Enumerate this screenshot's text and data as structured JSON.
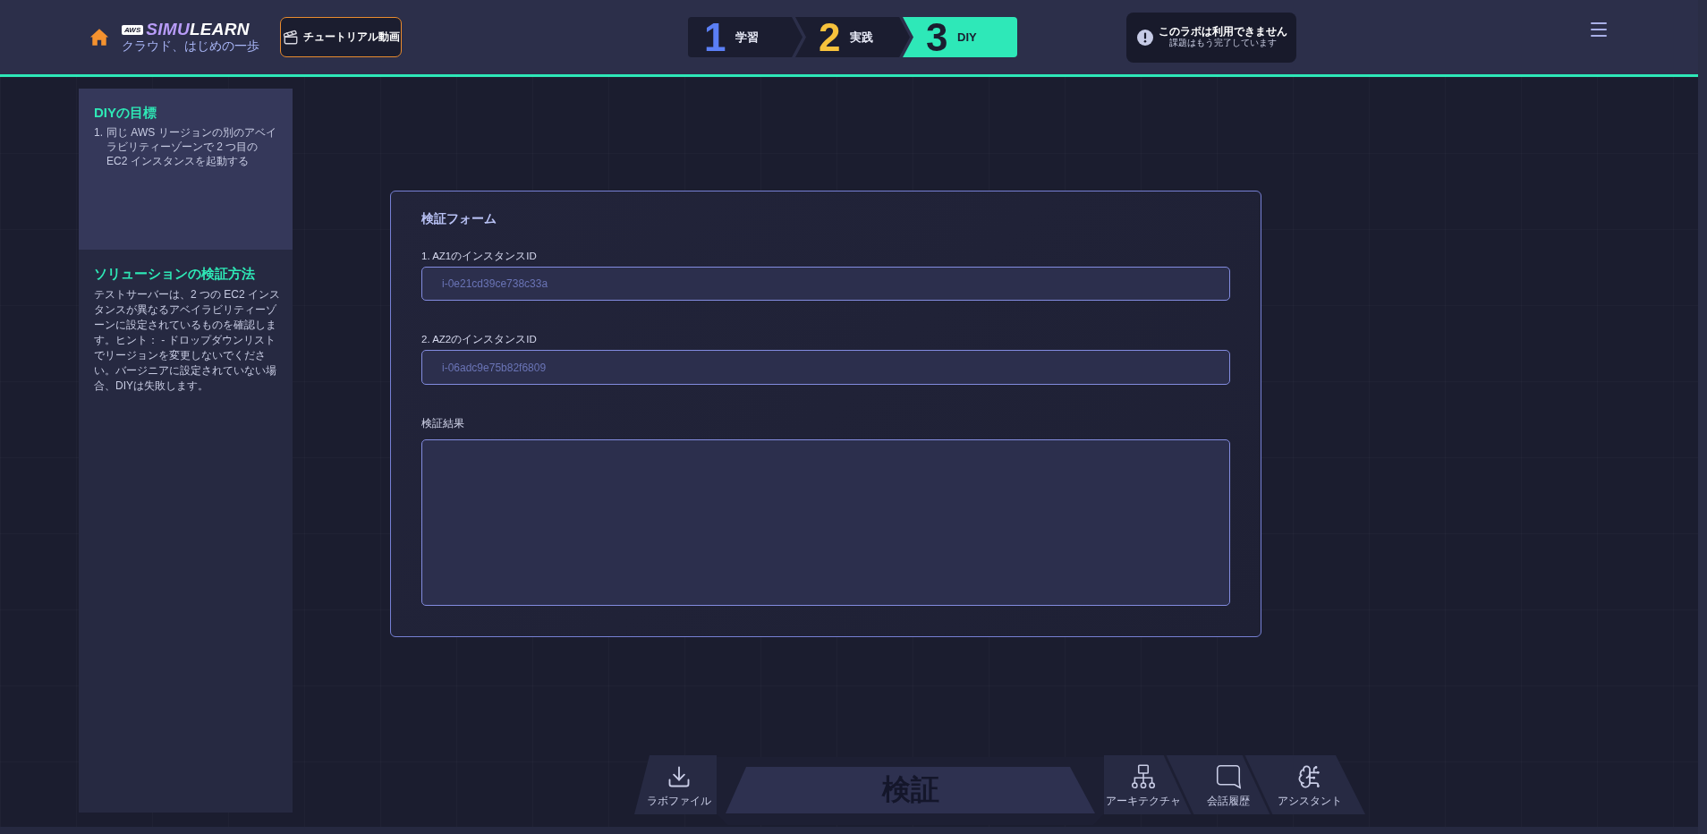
{
  "header": {
    "logo": {
      "badge": "AWS",
      "wordmark_parts": [
        "SIMU",
        "LEARN"
      ],
      "tagline": "クラウド、はじめの一歩"
    },
    "tutorial_button": {
      "label": "チュートリアル動画"
    },
    "steps": [
      {
        "number": "1",
        "label": "学習",
        "selected": false,
        "color": "#5b7ff5"
      },
      {
        "number": "2",
        "label": "実践",
        "selected": false,
        "color": "#f7c23c"
      },
      {
        "number": "3",
        "label": "DIY",
        "selected": true,
        "color": "#2ee8b8"
      }
    ],
    "notice": {
      "title": "このラボは利用できません",
      "subtitle": "課題はもう完了しています"
    }
  },
  "sidebar": {
    "sections": [
      {
        "kind": "goal",
        "title": "DIYの目標",
        "items": [
          {
            "number": "1.",
            "text": "同じ AWS リージョンの別のアベイラビリティーゾーンで 2 つ目の EC2 インスタンスを起動する"
          }
        ]
      },
      {
        "kind": "method",
        "title": "ソリューションの検証方法",
        "text": "テストサーバーは、2 つの EC2 インスタンスが異なるアベイラビリティーゾーンに設定されているものを確認します。ヒント： - ドロップダウンリストでリージョンを変更しないでください。バージニアに設定されていない場合、DIYは失敗します。"
      }
    ]
  },
  "form": {
    "title": "検証フォーム",
    "fields": [
      {
        "kind": "input",
        "label": "1. AZ1のインスタンスID",
        "value": "i-0e21cd39ce738c33a",
        "disabled": true
      },
      {
        "kind": "input",
        "label": "2. AZ2のインスタンスID",
        "value": "i-06adc9e75b82f6809",
        "disabled": true
      },
      {
        "kind": "textarea",
        "label": "検証結果"
      }
    ]
  },
  "toolbar": {
    "items": [
      {
        "kind": "download",
        "label": "ラボファイル"
      },
      {
        "kind": "verify",
        "label": "検証",
        "disabled": true
      },
      {
        "kind": "architecture",
        "label": "アーキテクチャ"
      },
      {
        "kind": "chat",
        "label": "会話履歴"
      },
      {
        "kind": "assistant",
        "label": "アシスタント"
      }
    ]
  }
}
